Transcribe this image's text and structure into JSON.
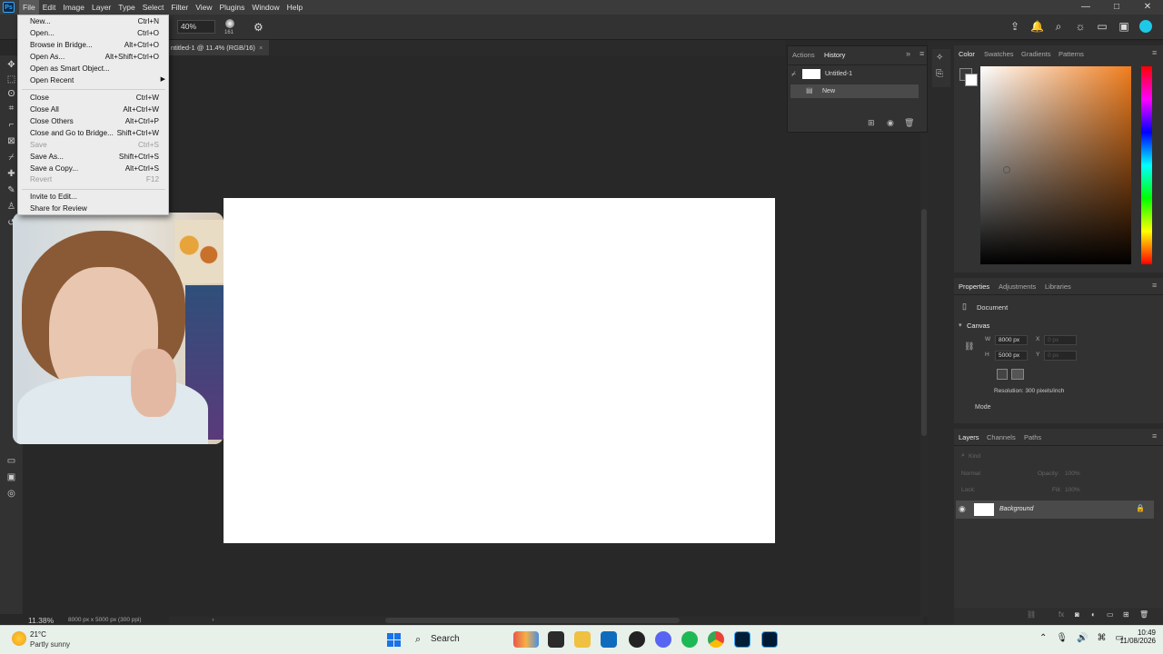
{
  "app": {
    "logo": "Ps"
  },
  "menubar": [
    "File",
    "Edit",
    "Image",
    "Layer",
    "Type",
    "Select",
    "Filter",
    "View",
    "Plugins",
    "Window",
    "Help"
  ],
  "window_controls": [
    "—",
    "□",
    "✕"
  ],
  "options": {
    "zoom": "40%",
    "brush_size": "161"
  },
  "document_tab": {
    "title": "ntitled-1 @ 11.4% (RGB/16)",
    "close": "×"
  },
  "file_menu": {
    "items": [
      {
        "label": "New...",
        "shortcut": "Ctrl+N",
        "enabled": true
      },
      {
        "label": "Open...",
        "shortcut": "Ctrl+O",
        "enabled": true
      },
      {
        "label": "Browse in Bridge...",
        "shortcut": "Alt+Ctrl+O",
        "enabled": true
      },
      {
        "label": "Open As...",
        "shortcut": "Alt+Shift+Ctrl+O",
        "enabled": true
      },
      {
        "label": "Open as Smart Object...",
        "shortcut": "",
        "enabled": true
      },
      {
        "label": "Open Recent",
        "shortcut": "",
        "enabled": true,
        "submenu": true
      },
      {
        "label": "Close",
        "shortcut": "Ctrl+W",
        "enabled": true
      },
      {
        "label": "Close All",
        "shortcut": "Alt+Ctrl+W",
        "enabled": true
      },
      {
        "label": "Close Others",
        "shortcut": "Alt+Ctrl+P",
        "enabled": true
      },
      {
        "label": "Close and Go to Bridge...",
        "shortcut": "Shift+Ctrl+W",
        "enabled": true
      },
      {
        "label": "Save",
        "shortcut": "Ctrl+S",
        "enabled": false
      },
      {
        "label": "Save As...",
        "shortcut": "Shift+Ctrl+S",
        "enabled": true
      },
      {
        "label": "Save a Copy...",
        "shortcut": "Alt+Ctrl+S",
        "enabled": true
      },
      {
        "label": "Revert",
        "shortcut": "F12",
        "enabled": false
      },
      {
        "label": "Invite to Edit...",
        "shortcut": "",
        "enabled": true
      },
      {
        "label": "Share for Review",
        "shortcut": "",
        "enabled": true
      }
    ]
  },
  "history_panel": {
    "tabs": [
      "Actions",
      "History"
    ],
    "snapshot": "Untitled-1",
    "states": [
      "New"
    ]
  },
  "color_panel": {
    "tabs": [
      "Color",
      "Swatches",
      "Gradients",
      "Patterns"
    ],
    "accent": "#f07d1e"
  },
  "properties_panel": {
    "tabs": [
      "Properties",
      "Adjustments",
      "Libraries"
    ],
    "type": "Document",
    "section": "Canvas",
    "w_label": "W",
    "w_value": "8000 px",
    "h_label": "H",
    "h_value": "5000 px",
    "x_label": "X",
    "x_value": "0 px",
    "y_label": "Y",
    "y_value": "0 px",
    "resolution": "Resolution: 300 pixels/inch",
    "mode": "Mode"
  },
  "layers_panel": {
    "tabs": [
      "Layers",
      "Channels",
      "Paths"
    ],
    "filter_placeholder": "Kind",
    "blend_mode": "Normal",
    "opacity_label": "Opacity:",
    "opacity": "100%",
    "lock_label": "Lock:",
    "fill_label": "Fill:",
    "fill": "100%",
    "layers": [
      {
        "name": "Background"
      }
    ]
  },
  "status": {
    "zoom": "11.38%",
    "info": "8000 px x 5000 px (300 ppi)",
    "arrow": "›"
  },
  "taskbar": {
    "weather_temp": "21°C",
    "weather_desc": "Partly sunny",
    "search": "Search",
    "time": "10:49",
    "date": "11/08/2026"
  }
}
